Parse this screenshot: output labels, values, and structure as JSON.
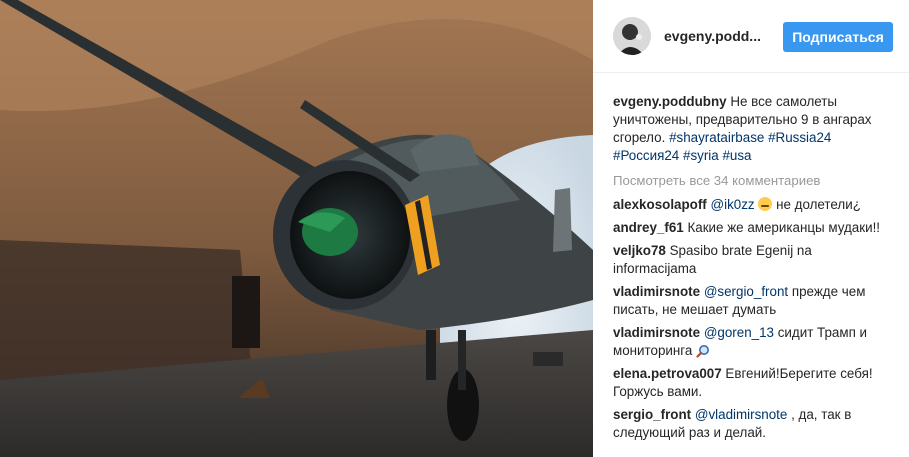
{
  "header": {
    "username": "evgeny.podd...",
    "follow_label": "Подписаться"
  },
  "caption": {
    "username": "evgeny.poddubny",
    "text": "Не все самолеты уничтожены, предварительно 9 в ангарах сгорело.",
    "tags": [
      "#shayratairbase",
      "#Russia24",
      "#Россия24",
      "#syria",
      "#usa"
    ]
  },
  "view_all_label": "Посмотреть все 34 комментариев",
  "comments": [
    {
      "user": "alexkosolapoff",
      "mention": "@ik0zz",
      "emoji": "crying-laughing-emoji",
      "text": "не долетели¿"
    },
    {
      "user": "andrey_f61",
      "mention": "",
      "text": "Какие же американцы мудаки!!"
    },
    {
      "user": "veljko78",
      "mention": "",
      "text": "Spasibo brate Egenij na informacijama"
    },
    {
      "user": "vladimirsnote",
      "mention": "@sergio_front",
      "text": "прежде чем писать, не мешает думать"
    },
    {
      "user": "vladimirsnote",
      "mention": "@goren_13",
      "text": "сидит Трамп и мониторинга",
      "emoji_after": "magnifier-icon"
    },
    {
      "user": "elena.petrova007",
      "mention": "",
      "text": "Евгений!Берегите себя!Горжусь вами."
    },
    {
      "user": "sergio_front",
      "mention": "@vladimirsnote",
      "text": ", да, так в следующий раз и делай."
    }
  ],
  "colors": {
    "follow_bg": "#3897f0",
    "link": "#003569",
    "muted": "#999999"
  }
}
